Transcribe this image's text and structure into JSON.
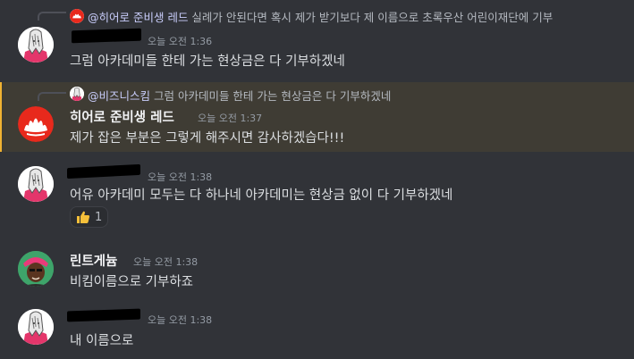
{
  "messages": [
    {
      "reply": {
        "mention": "@히어로 준비생 레드",
        "text": " 실례가 안된다면 혹시 제가 받기보다 제 이름으로 초록우산 어린이재단에 기부"
      },
      "timestamp": "오늘 오전 1:36",
      "content": "그럼 아카데미들 한테 가는 현상금은 다 기부하겠네"
    },
    {
      "reply": {
        "mention": "@비즈니스킴",
        "text": " 그럼 아카데미들 한테 가는 현상금은 다 기부하겠네"
      },
      "author": "히어로 준비생 레드",
      "timestamp": "오늘 오전 1:37",
      "content": "제가 잡은 부분은 그렇게 해주시면 감사하겠습다!!!"
    },
    {
      "timestamp": "오늘 오전 1:38",
      "content": "어유 아카데미 모두는 다 하나네 아카데미는 현상금 없이 다 기부하겠네",
      "reaction": {
        "emoji": "thumbs-up-icon",
        "count": "1"
      }
    },
    {
      "author": "린트게늄",
      "timestamp": "오늘 오전 1:38",
      "content": "비킴이름으로 기부하죠"
    },
    {
      "timestamp": "오늘 오전 1:38",
      "content": "내 이름으로"
    }
  ],
  "colors": {
    "background": "#313338",
    "highlight_background": "#3f3c34",
    "highlight_bar": "#f0b232",
    "mention": "#c9cdfb",
    "red_avatar": "#e8291c",
    "pink_shirt": "#e4366b"
  }
}
